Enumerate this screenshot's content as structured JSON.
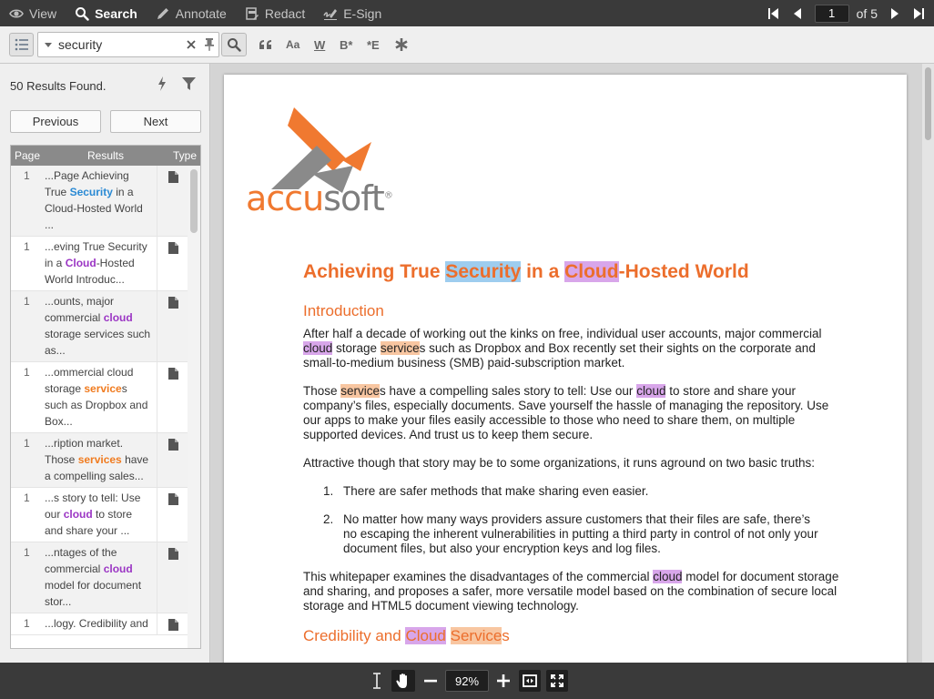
{
  "topbar": {
    "modes": [
      {
        "label": "View",
        "icon": "eye-icon"
      },
      {
        "label": "Search",
        "icon": "search-icon"
      },
      {
        "label": "Annotate",
        "icon": "pen-icon"
      },
      {
        "label": "Redact",
        "icon": "redact-icon"
      },
      {
        "label": "E-Sign",
        "icon": "signature-icon"
      }
    ],
    "active_mode": "Search",
    "pager": {
      "current_page": "1",
      "of_label": "of 5"
    }
  },
  "searchbar": {
    "query": "security",
    "options": [
      "quotes-icon",
      "Aa",
      "W",
      "B*",
      "*E",
      "asterisk-icon"
    ]
  },
  "results": {
    "count_label": "50 Results Found.",
    "prev_label": "Previous",
    "next_label": "Next",
    "columns": [
      "Page",
      "Results",
      "Type"
    ],
    "rows": [
      {
        "page": "1",
        "pre": "...Page Achieving True ",
        "hit": "Security",
        "post": " in a Cloud-Hosted World ...",
        "color": "blue"
      },
      {
        "page": "1",
        "pre": "...eving True Security in a ",
        "hit": "Cloud",
        "post": "-Hosted World Introduc...",
        "color": "purple"
      },
      {
        "page": "1",
        "pre": "...ounts, major commercial ",
        "hit": "cloud",
        "post": " storage services such as...",
        "color": "purple"
      },
      {
        "page": "1",
        "pre": "...ommercial cloud storage ",
        "hit": "service",
        "post": "s such as Dropbox and Box...",
        "color": "orange"
      },
      {
        "page": "1",
        "pre": "...ription market. Those ",
        "hit": "services",
        "post": " have a compelling sales...",
        "color": "orange"
      },
      {
        "page": "1",
        "pre": "...s story to tell: Use our ",
        "hit": "cloud",
        "post": " to store and share your ...",
        "color": "purple"
      },
      {
        "page": "1",
        "pre": "...ntages of the commercial ",
        "hit": "cloud",
        "post": " model for document stor...",
        "color": "purple"
      },
      {
        "page": "1",
        "pre": "...logy. Credibility and ",
        "hit": "",
        "post": "",
        "color": "purple"
      }
    ]
  },
  "document": {
    "logo": {
      "accu": "accu",
      "soft": "soft",
      "mark": "®"
    },
    "title": {
      "a": "Achieving True ",
      "b": "Security",
      "c": " in a ",
      "d": "Cloud",
      "e": "-Hosted World"
    },
    "h_intro": "Introduction",
    "p1": {
      "a": "After half a decade of working out the kinks on free, individual user accounts, major commercial ",
      "b": "cloud",
      "c": " storage ",
      "d": "service",
      "e": "s such as Dropbox and Box recently set their sights on the corporate and small-to-medium business (SMB) paid-subscription market."
    },
    "p2": {
      "a": "Those ",
      "b": "service",
      "c": "s have a compelling sales story to tell: Use our ",
      "d": "cloud",
      "e": " to store and share your company’s files, especially documents. Save yourself the hassle of managing the repository. Use our apps to make your files easily accessible to those who need to share them, on multiple supported devices. And trust us to keep them secure."
    },
    "p3": "Attractive though that story may be to some organizations, it runs aground on two basic truths:",
    "list": [
      {
        "n": "1.",
        "t": "There are safer methods that make sharing even easier."
      },
      {
        "n": "2.",
        "t": "No matter how many ways providers assure customers that their files are safe, there’s no escaping the inherent vulnerabilities in putting a third party in control of not only your document files, but also your encryption keys and log files."
      }
    ],
    "p4": {
      "a": "This whitepaper examines the disadvantages of the commercial ",
      "b": "cloud",
      "c": " model for document storage and sharing, and proposes a safer, more versatile model based on the combination of secure local storage and HTML5 document viewing technology."
    },
    "h_cred": {
      "a": "Credibility and ",
      "b": "Cloud",
      "c": " ",
      "d": "Service",
      "e": "s"
    }
  },
  "bottombar": {
    "zoom": "92%",
    "tools": [
      "text-cursor-icon",
      "hand-icon",
      "zoom-out-icon",
      "zoom-in-icon",
      "fit-width-icon",
      "fullscreen-icon"
    ]
  },
  "colors": {
    "accent": "#ec6e2c",
    "blue_hit": "#2a8ad4",
    "purple_hit": "#9b36c4",
    "orange_hit": "#f07b1f",
    "toolbar": "#3a3a3a"
  }
}
